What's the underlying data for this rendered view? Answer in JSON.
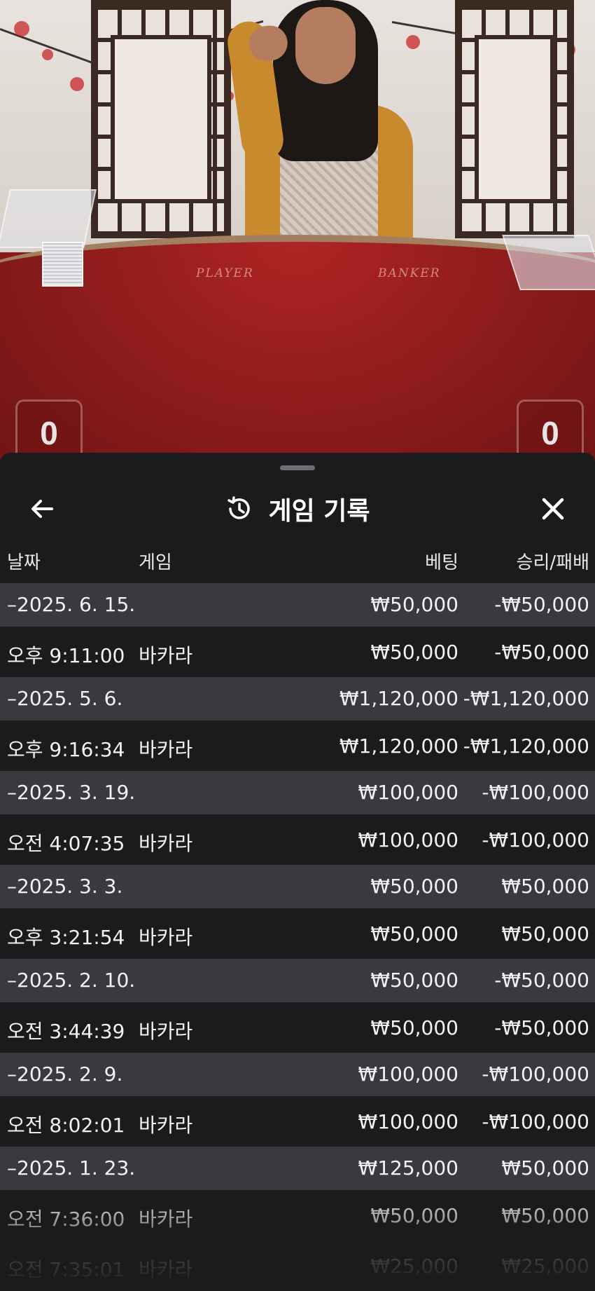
{
  "video": {
    "felt_labels": [
      "PLAYER",
      "BANKER"
    ],
    "player_score": "0",
    "banker_score": "0"
  },
  "sheet": {
    "title": "게임 기록",
    "icons": {
      "back": "arrow-left-icon",
      "title": "history-icon",
      "close": "close-icon"
    },
    "columns": {
      "date": "날짜",
      "game": "게임",
      "bet": "베팅",
      "win_loss": "승리/패배"
    },
    "rows": [
      {
        "type": "date",
        "date": "–2025. 6. 15.",
        "game": "",
        "bet": "₩50,000",
        "win_loss": "-₩50,000"
      },
      {
        "type": "time",
        "date": "오후 9:11:00",
        "game": "바카라",
        "bet": "₩50,000",
        "win_loss": "-₩50,000"
      },
      {
        "type": "date",
        "date": "–2025. 5. 6.",
        "game": "",
        "bet": "₩1,120,000",
        "win_loss": "-₩1,120,000"
      },
      {
        "type": "time",
        "date": "오후 9:16:34",
        "game": "바카라",
        "bet": "₩1,120,000",
        "win_loss": "-₩1,120,000"
      },
      {
        "type": "date",
        "date": "–2025. 3. 19.",
        "game": "",
        "bet": "₩100,000",
        "win_loss": "-₩100,000"
      },
      {
        "type": "time",
        "date": "오전 4:07:35",
        "game": "바카라",
        "bet": "₩100,000",
        "win_loss": "-₩100,000"
      },
      {
        "type": "date",
        "date": "–2025. 3. 3.",
        "game": "",
        "bet": "₩50,000",
        "win_loss": "₩50,000"
      },
      {
        "type": "time",
        "date": "오후 3:21:54",
        "game": "바카라",
        "bet": "₩50,000",
        "win_loss": "₩50,000"
      },
      {
        "type": "date",
        "date": "–2025. 2. 10.",
        "game": "",
        "bet": "₩50,000",
        "win_loss": "-₩50,000"
      },
      {
        "type": "time",
        "date": "오전 3:44:39",
        "game": "바카라",
        "bet": "₩50,000",
        "win_loss": "-₩50,000"
      },
      {
        "type": "date",
        "date": "–2025. 2. 9.",
        "game": "",
        "bet": "₩100,000",
        "win_loss": "-₩100,000"
      },
      {
        "type": "time",
        "date": "오전 8:02:01",
        "game": "바카라",
        "bet": "₩100,000",
        "win_loss": "-₩100,000"
      },
      {
        "type": "date",
        "date": "–2025. 1. 23.",
        "game": "",
        "bet": "₩125,000",
        "win_loss": "₩50,000"
      },
      {
        "type": "time",
        "date": "오전 7:36:00",
        "game": "바카라",
        "bet": "₩50,000",
        "win_loss": "₩50,000"
      },
      {
        "type": "time",
        "date": "오전 7:35:01",
        "game": "바카라",
        "bet": "₩25,000",
        "win_loss": "₩25,000"
      }
    ]
  }
}
